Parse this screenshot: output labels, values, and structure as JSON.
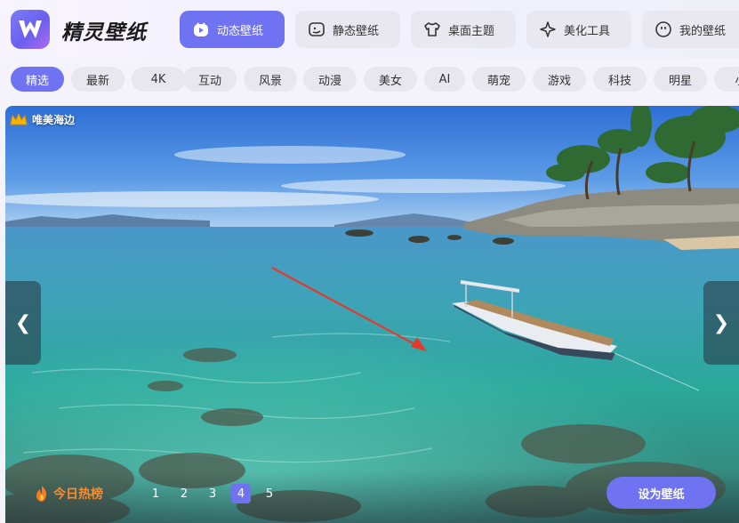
{
  "app": {
    "title": "精灵壁纸",
    "logo_icon": "wallpaper-logo-icon"
  },
  "nav": {
    "tabs": [
      {
        "label": "动态壁纸",
        "icon": "play-icon",
        "active": true
      },
      {
        "label": "静态壁纸",
        "icon": "image-face-icon",
        "active": false
      },
      {
        "label": "桌面主题",
        "icon": "tshirt-icon",
        "active": false
      },
      {
        "label": "美化工具",
        "icon": "sparkle-tool-icon",
        "active": false
      },
      {
        "label": "我的壁纸",
        "icon": "smile-icon",
        "active": false
      }
    ]
  },
  "categories": [
    {
      "label": "精选",
      "active": true
    },
    {
      "label": "最新"
    },
    {
      "label": "4K"
    },
    {
      "label": "互动"
    },
    {
      "label": "风景"
    },
    {
      "label": "动漫"
    },
    {
      "label": "美女"
    },
    {
      "label": "AI"
    },
    {
      "label": "萌宠"
    },
    {
      "label": "游戏"
    },
    {
      "label": "科技"
    },
    {
      "label": "明星"
    },
    {
      "label": "小"
    }
  ],
  "hero": {
    "badge": "唯美海边",
    "badge_icon": "crown-icon",
    "prev_arrow": "❮",
    "next_arrow": "❯",
    "hot_label": "今日热榜",
    "hot_icon": "flame-icon",
    "pages": [
      "1",
      "2",
      "3",
      "4",
      "5"
    ],
    "current_page": "4",
    "set_button": "设为壁纸"
  },
  "colors": {
    "accent": "#6f73f2",
    "hot": "#ff8a2a"
  }
}
